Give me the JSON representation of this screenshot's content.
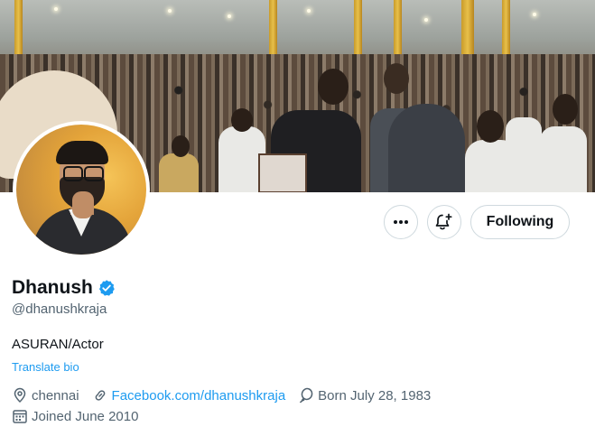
{
  "profile": {
    "name": "Dhanush",
    "handle": "@dhanushkraja",
    "bio": "ASURAN/Actor",
    "translate_label": "Translate bio",
    "location": "chennai",
    "website": "Facebook.com/dhanushkraja",
    "birthday": "Born July 28, 1983",
    "joined": "Joined June 2010",
    "verified": true
  },
  "actions": {
    "more_icon": "more-icon",
    "notify_icon": "bell-plus-icon",
    "following_label": "Following"
  },
  "colors": {
    "accent": "#1d9bf0",
    "text_primary": "#0f1419",
    "text_secondary": "#536471",
    "border": "#cfd9de"
  }
}
